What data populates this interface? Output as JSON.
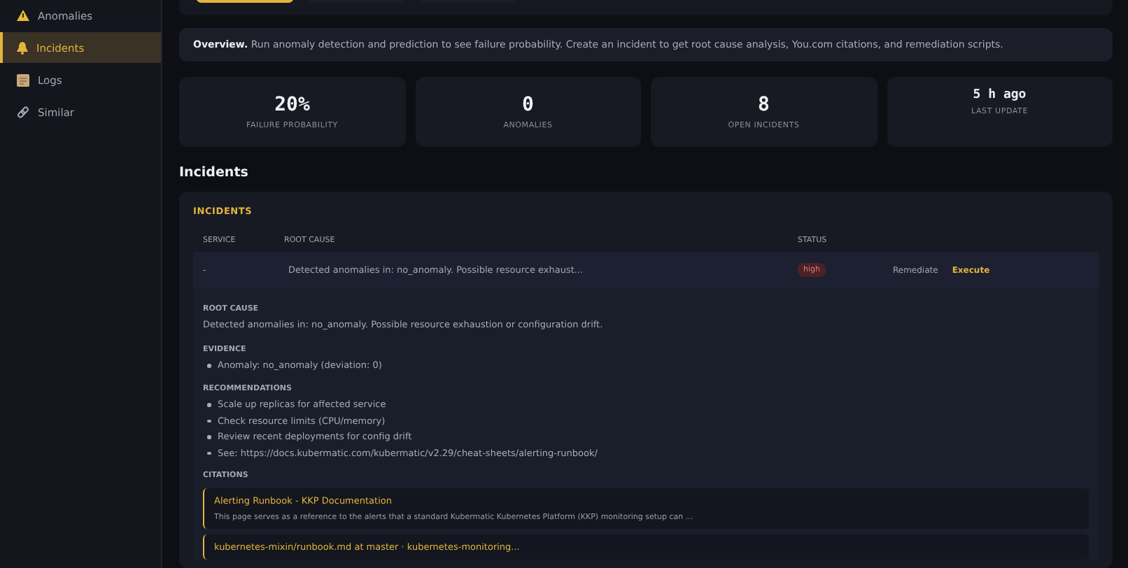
{
  "sidebar": {
    "items": [
      {
        "label": "Anomalies",
        "kind": "warning",
        "selected": false
      },
      {
        "label": "Incidents",
        "kind": "bell",
        "selected": true
      },
      {
        "label": "Logs",
        "kind": "scroll",
        "selected": false
      },
      {
        "label": "Similar",
        "kind": "link",
        "selected": false
      }
    ]
  },
  "toolbar": {
    "buttons": [
      {
        "selected": true
      },
      {
        "selected": false
      },
      {
        "selected": false
      }
    ]
  },
  "overview": {
    "title": "Overview.",
    "text": "Run anomaly detection and prediction to see failure probability. Create an incident to get root cause analysis, You.com citations, and remediation scripts."
  },
  "stats": [
    {
      "value": "20%",
      "label": "FAILURE PROBABILITY"
    },
    {
      "value": "0",
      "label": "ANOMALIES"
    },
    {
      "value": "8",
      "label": "OPEN INCIDENTS"
    },
    {
      "value": "5 h ago",
      "label": "LAST UPDATE",
      "kind": "time"
    }
  ],
  "section_title": "Incidents",
  "incidents": {
    "title": "INCIDENTS",
    "columns": [
      "SERVICE",
      "ROOT CAUSE",
      "STATUS"
    ],
    "rows": [
      {
        "service": "-",
        "root_cause": "Detected anomalies in: no_anomaly. Possible resource exhaust...",
        "status": "high",
        "actions": [
          {
            "label": "Remediate",
            "kind": "plain"
          },
          {
            "label": "Execute",
            "kind": "accent"
          }
        ],
        "expanded": true,
        "detail": {
          "root_cause_title": "ROOT CAUSE",
          "root_cause": "Detected anomalies in: no_anomaly. Possible resource exhaustion or configuration drift.",
          "evidence_title": "EVIDENCE",
          "evidence": [
            "Anomaly: no_anomaly (deviation: 0)"
          ],
          "recommendations_title": "RECOMMENDATIONS",
          "recommendations": [
            "Scale up replicas for affected service",
            "Check resource limits (CPU/memory)",
            "Review recent deployments for config drift",
            "See: https://docs.kubermatic.com/kubermatic/v2.29/cheat-sheets/alerting-runbook/"
          ],
          "citations_title": "CITATIONS",
          "citations": [
            {
              "title": "Alerting Runbook - KKP Documentation",
              "snippet": "This page serves as a reference to the alerts that a standard Kubermatic Kubernetes Platform (KKP) monitoring setup can ..."
            },
            {
              "title": "kubernetes-mixin/runbook.md at master · kubernetes-monitoring..."
            }
          ]
        }
      }
    ]
  }
}
